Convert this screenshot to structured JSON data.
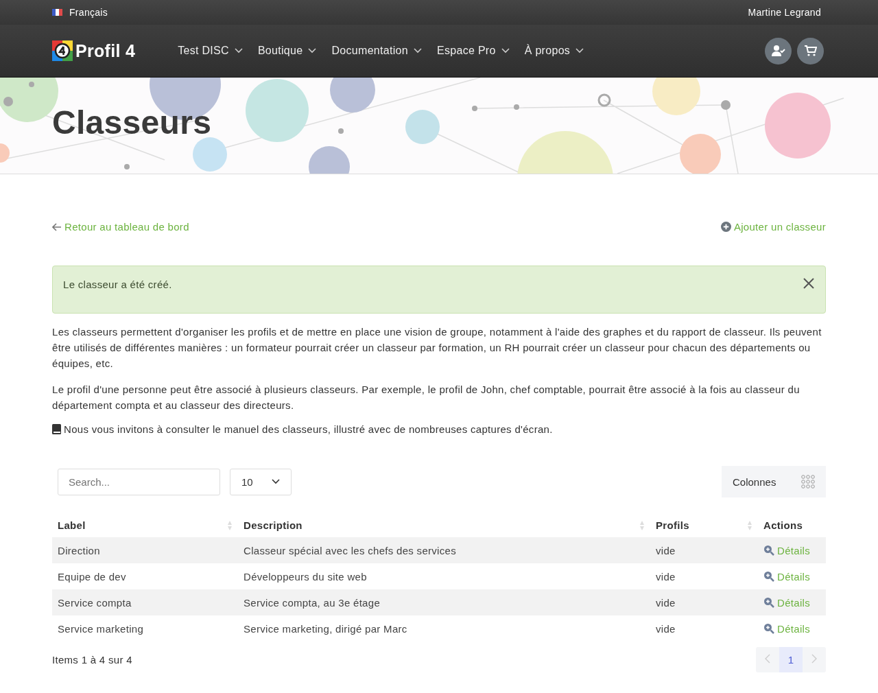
{
  "topbar": {
    "language": "Français",
    "user": "Martine Legrand"
  },
  "nav": {
    "logo": "Profil 4",
    "items": [
      "Test DISC",
      "Boutique",
      "Documentation",
      "Espace Pro",
      "À propos"
    ]
  },
  "banner": {
    "title": "Classeurs"
  },
  "links": {
    "back": "Retour au tableau de bord",
    "add": "Ajouter un classeur"
  },
  "alert": {
    "message": "Le classeur a été créé."
  },
  "paragraphs": [
    "Les classeurs permettent d'organiser les profils et de mettre en place une vision de groupe, notamment à l'aide des graphes et du rapport de classeur. Ils peuvent être utilisés de différentes manières : un formateur pourrait créer un classeur par formation, un RH pourrait créer un classeur pour chacun des départements ou équipes, etc.",
    "Le profil d'une personne peut être associé à plusieurs classeurs. Par exemple, le profil de John, chef comptable, pourrait être associé à la fois au classeur du département compta et au classeur des directeurs."
  ],
  "manual_note": "Nous vous invitons à consulter le manuel des classeurs, illustré avec de nombreuses captures d'écran.",
  "table": {
    "search": {
      "placeholder": "Search..."
    },
    "page_size": "10",
    "columns_button": "Colonnes",
    "columns": [
      {
        "label": "Label",
        "sortable": true
      },
      {
        "label": "Description",
        "sortable": true
      },
      {
        "label": "Profils",
        "sortable": true
      },
      {
        "label": "Actions",
        "sortable": false
      }
    ],
    "rows": [
      {
        "label": "Direction",
        "description": "Classeur spécial avec les chefs des services",
        "profils": "vide",
        "action": "Détails"
      },
      {
        "label": "Equipe de dev",
        "description": "Développeurs du site web",
        "profils": "vide",
        "action": "Détails"
      },
      {
        "label": "Service compta",
        "description": "Service compta, au 3e étage",
        "profils": "vide",
        "action": "Détails"
      },
      {
        "label": "Service marketing",
        "description": "Service marketing, dirigé par Marc",
        "profils": "vide",
        "action": "Détails"
      }
    ],
    "summary": "Items 1 à 4 sur 4",
    "pages": [
      {
        "label": "1",
        "selected": true
      }
    ]
  }
}
